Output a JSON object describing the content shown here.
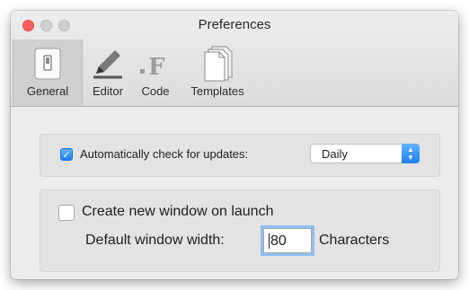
{
  "window": {
    "title": "Preferences"
  },
  "tabs": [
    {
      "label": "General",
      "icon": "general-switch-icon",
      "active": true
    },
    {
      "label": "Editor",
      "icon": "pencil-icon",
      "active": false
    },
    {
      "label": "Code",
      "icon": "code-f-icon",
      "active": false
    },
    {
      "label": "Templates",
      "icon": "templates-documents-icon",
      "active": false
    }
  ],
  "updates": {
    "label": "Automatically check for updates:",
    "checked": true,
    "frequency": "Daily"
  },
  "launch": {
    "label": "Create new window on launch",
    "checked": false,
    "width_label": "Default window width:",
    "width_value": "80",
    "width_unit": "Characters"
  },
  "colors": {
    "accent": "#1f7ef0",
    "close": "#fc605c"
  }
}
